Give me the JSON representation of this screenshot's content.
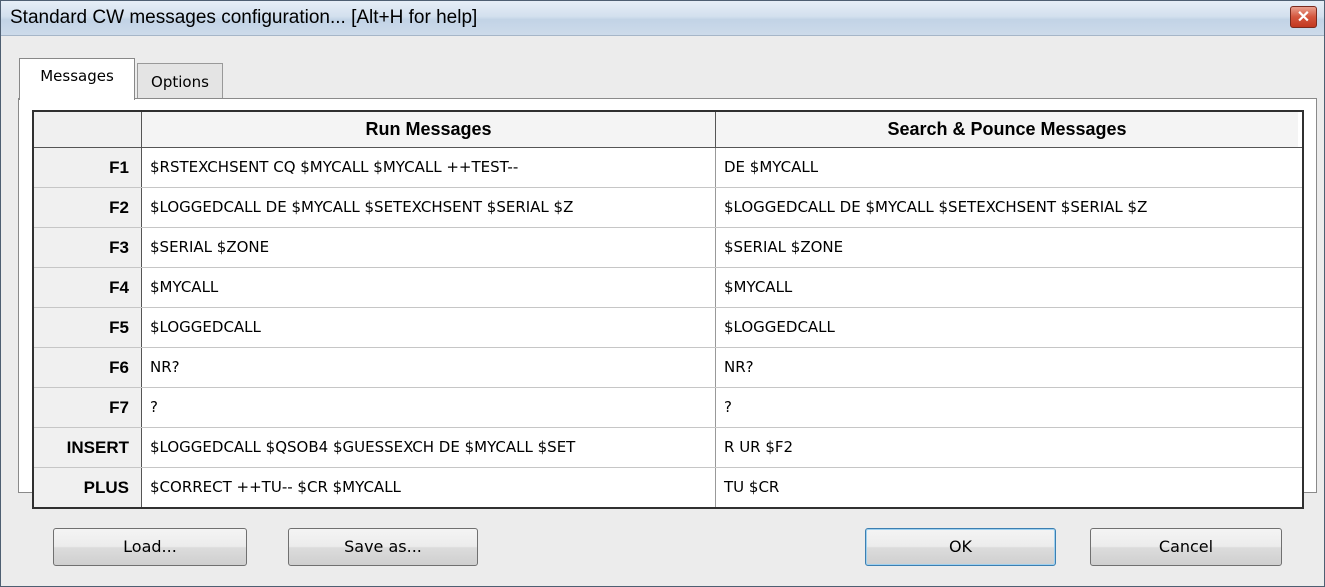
{
  "window": {
    "title": "Standard CW messages configuration... [Alt+H for help]",
    "close_glyph": "✕"
  },
  "tabs": [
    {
      "label": "Messages",
      "selected": true
    },
    {
      "label": "Options",
      "selected": false
    }
  ],
  "table": {
    "headers": [
      "",
      "Run Messages",
      "Search & Pounce Messages"
    ],
    "rows": [
      {
        "key": "F1",
        "run": "$RSTEXCHSENT CQ $MYCALL $MYCALL ++TEST--",
        "sp": "DE $MYCALL"
      },
      {
        "key": "F2",
        "run": "$LOGGEDCALL DE $MYCALL $SETEXCHSENT $SERIAL $Z",
        "sp": "$LOGGEDCALL DE $MYCALL $SETEXCHSENT $SERIAL $Z"
      },
      {
        "key": "F3",
        "run": "$SERIAL $ZONE",
        "sp": "$SERIAL $ZONE"
      },
      {
        "key": "F4",
        "run": "$MYCALL",
        "sp": "$MYCALL"
      },
      {
        "key": "F5",
        "run": "$LOGGEDCALL",
        "sp": "$LOGGEDCALL"
      },
      {
        "key": "F6",
        "run": "NR?",
        "sp": "NR?"
      },
      {
        "key": "F7",
        "run": "?",
        "sp": "?"
      },
      {
        "key": "INSERT",
        "run": "$LOGGEDCALL $QSOB4 $GUESSEXCH DE $MYCALL $SET",
        "sp": "R UR $F2"
      },
      {
        "key": "PLUS",
        "run": "$CORRECT ++TU-- $CR $MYCALL",
        "sp": "TU $CR"
      }
    ]
  },
  "buttons": {
    "load": "Load...",
    "save_as": "Save as...",
    "ok": "OK",
    "cancel": "Cancel"
  },
  "colors": {
    "titlebar": "#d3e0ee",
    "close_button": "#d4553d",
    "default_button_border": "#3c7fb1"
  }
}
